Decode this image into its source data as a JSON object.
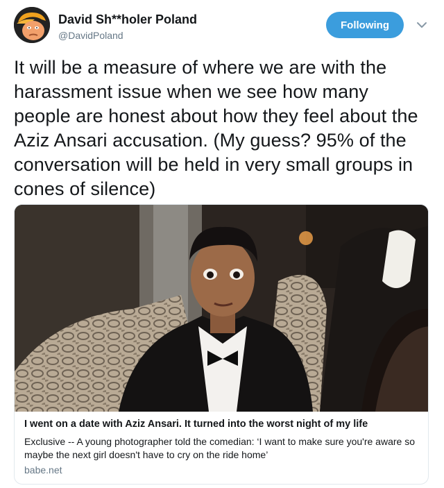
{
  "tweet": {
    "author_name": "David Sh**holer Poland",
    "author_handle": "@DavidPoland",
    "follow_label": "Following",
    "text": "It will be a measure of where we are with the harassment issue when we see how many people are honest about how they feel about the Aziz Ansari accusation. (My guess? 95% of the conversation will be held in very small groups in cones of silence)"
  },
  "link_card": {
    "title": "I went on a date with Aziz Ansari. It turned into the worst night of my life",
    "description": "Exclusive -- A young photographer told the comedian: ‘I want to make sure you're aware so maybe the next girl doesn't have to cry on the ride home’",
    "domain": "babe.net"
  },
  "icons": {
    "avatar": "caricature-avatar",
    "menu": "chevron-down-icon"
  },
  "colors": {
    "follow_button": "#3b9ddd",
    "secondary_text": "#657786"
  }
}
